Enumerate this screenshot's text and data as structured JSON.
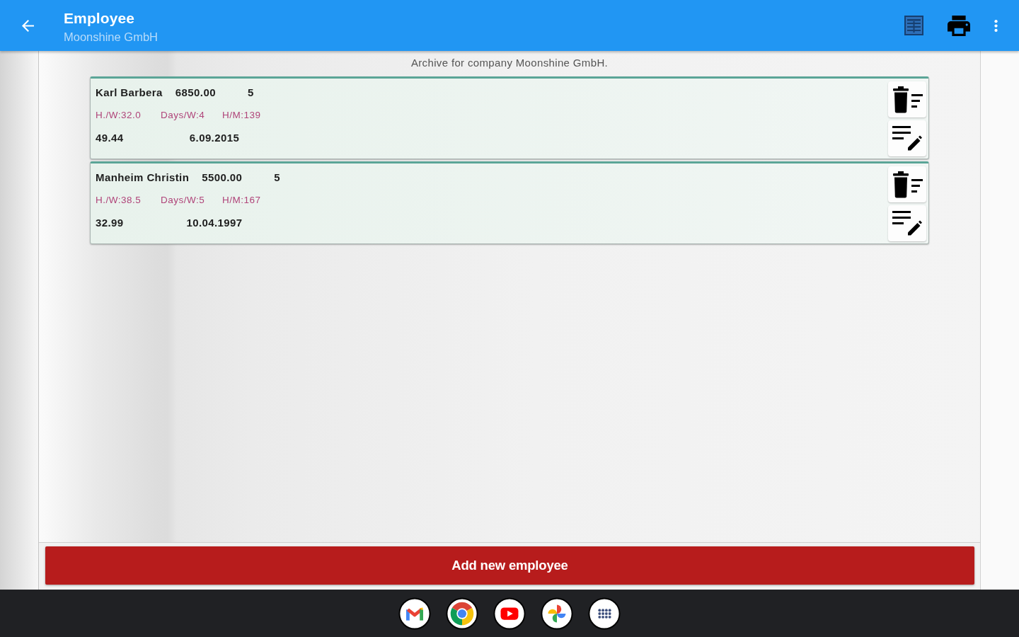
{
  "app_bar": {
    "title": "Employee",
    "subtitle": "Moonshine GmbH"
  },
  "caption": "Archive for company Moonshine GmbH.",
  "employees": [
    {
      "name": "Karl Barbera",
      "amount": "6850.00",
      "count": "5",
      "hours_per_week": "H./W:32.0",
      "days_per_week": "Days/W:4",
      "hours_per_month": "H/M:139",
      "rate": "49.44",
      "date": "6.09.2015"
    },
    {
      "name": "Manheim Christin",
      "amount": "5500.00",
      "count": "5",
      "hours_per_week": "H./W:38.5",
      "days_per_week": "Days/W:5",
      "hours_per_month": "H/M:167",
      "rate": "32.99",
      "date": "10.04.1997"
    }
  ],
  "add_button": {
    "label": "Add new employee"
  }
}
